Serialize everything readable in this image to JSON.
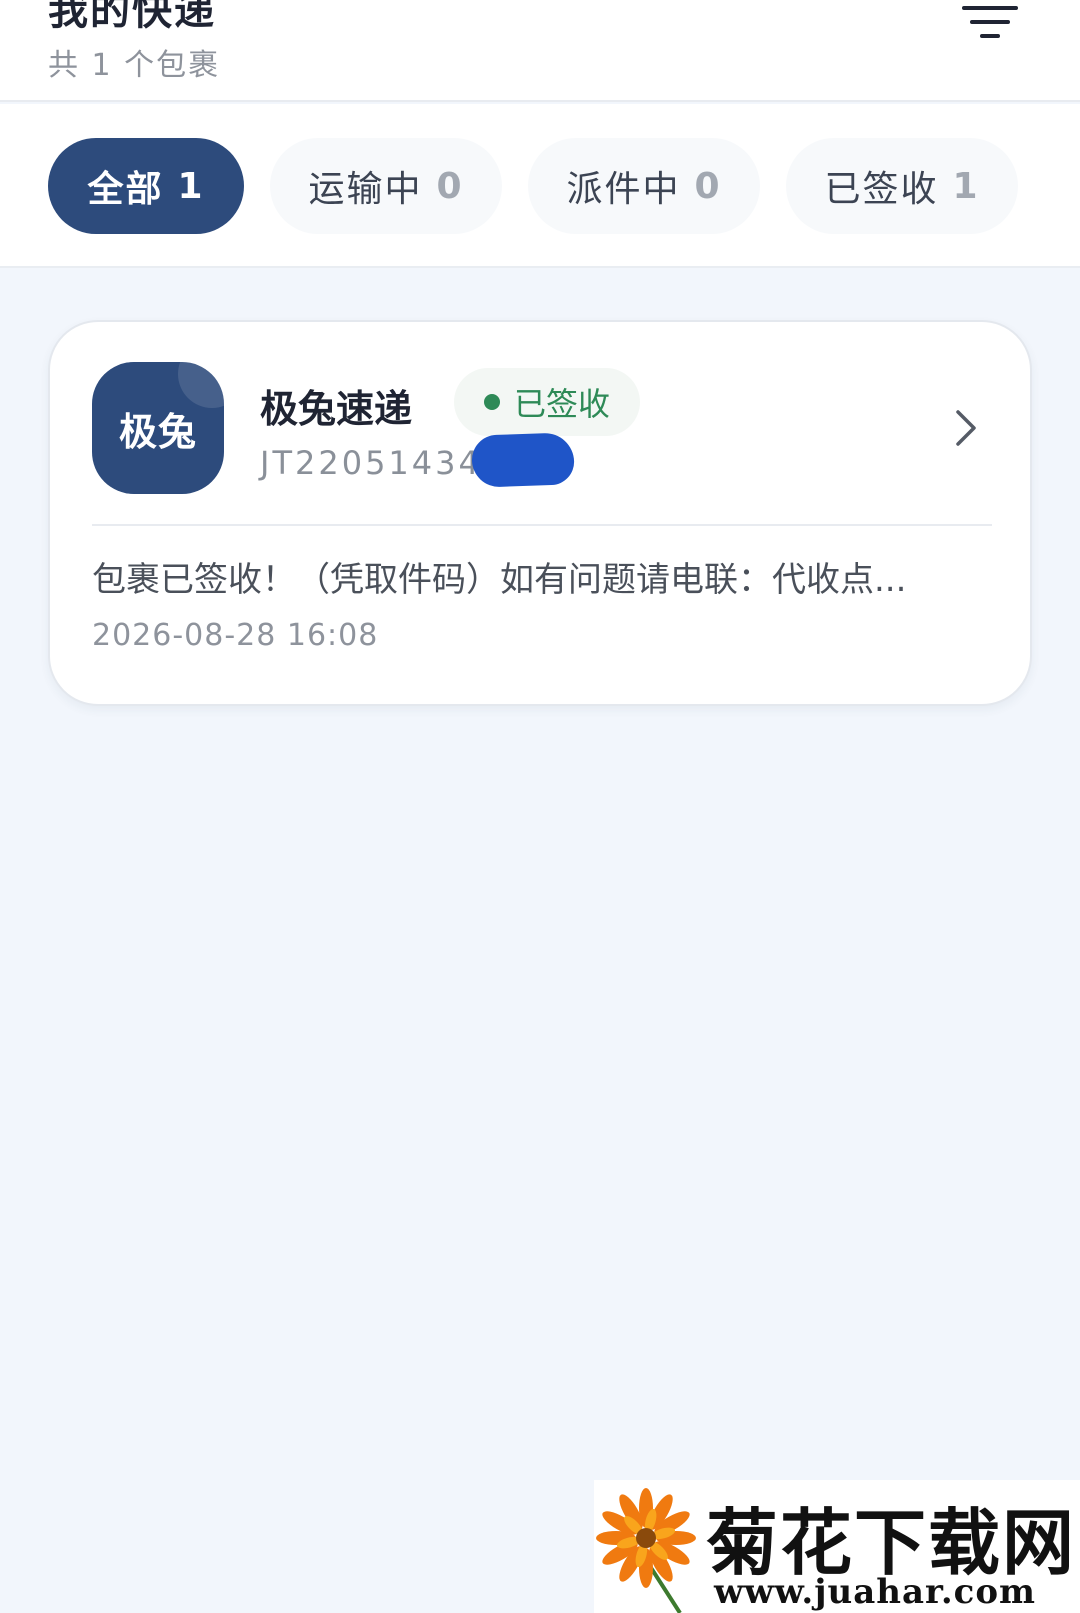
{
  "header": {
    "title": "我的快递",
    "subtitle": "共 1 个包裹",
    "filter_icon": "filter-lines-icon"
  },
  "tabs": [
    {
      "label": "全部",
      "count": "1",
      "active": true
    },
    {
      "label": "运输中",
      "count": "0",
      "active": false
    },
    {
      "label": "派件中",
      "count": "0",
      "active": false
    },
    {
      "label": "已签收",
      "count": "1",
      "active": false
    }
  ],
  "packages": [
    {
      "logo_text": "极兔",
      "company": "极兔速递",
      "status": "已签收",
      "tracking_no": "JT22051434",
      "message": "包裹已签收！（凭取件码）如有问题请电联：代收点...",
      "time": "2026-08-28 16:08"
    }
  ],
  "watermark": {
    "title": "菊花下载网",
    "url": "www.juahar.com"
  },
  "colors": {
    "primary": "#2d4b7c",
    "status_green": "#2e8a57",
    "page_bg": "#f2f6fc",
    "redaction": "#1f55c8"
  }
}
